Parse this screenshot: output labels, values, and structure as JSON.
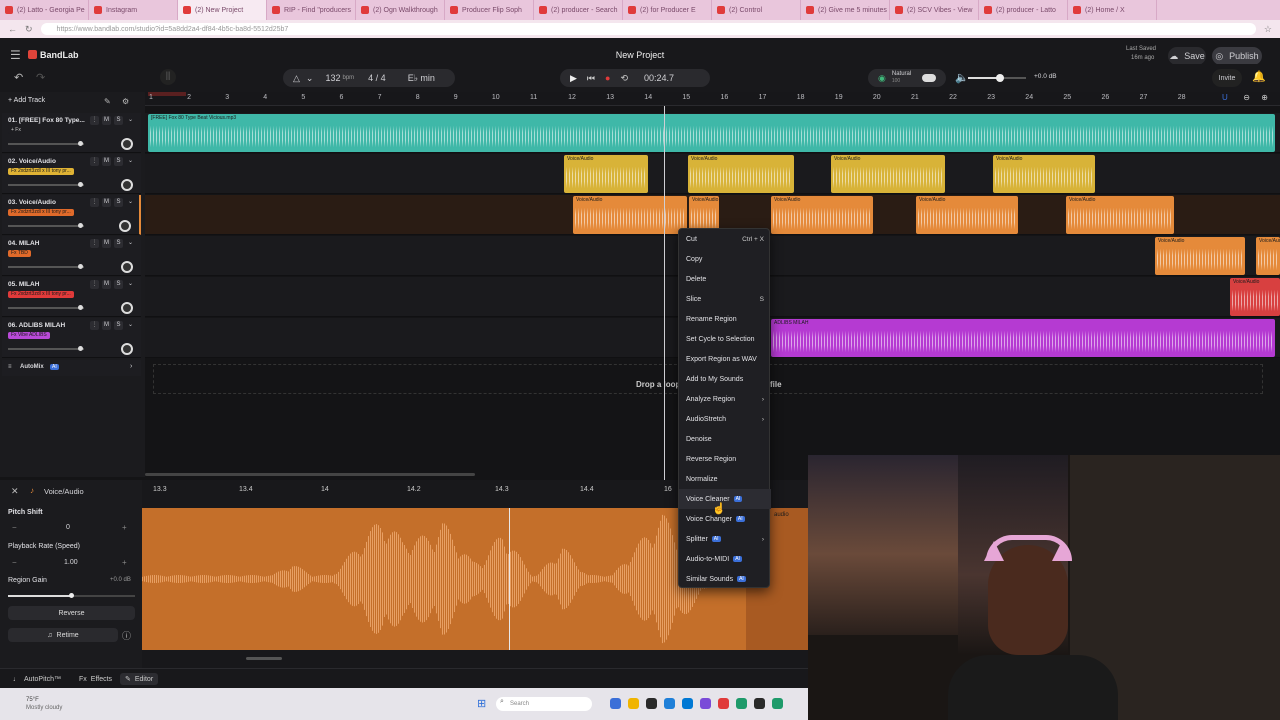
{
  "browser": {
    "tabs": [
      "(2) Latto - Georgia Pe",
      "Instagram",
      "(2) New Project",
      "RIP - Find \"producers",
      "(2) Ogn Walkthrough",
      "Producer Flip Soph",
      "(2) producer - Search",
      "(2) for Producer E",
      "(2) Control",
      "(2) Give me 5 minutes",
      "(2) SCV Vibes - View",
      "(2) producer - Latto",
      "(2) Home / X"
    ],
    "url": "https://www.bandlab.com/studio?id=5a8dd2a4-df84-4b5c-ba8d-5512d25b7"
  },
  "app": {
    "brand": "BandLab",
    "project_title": "New Project",
    "last_saved_label": "Last Saved",
    "last_saved_time": "16m ago",
    "save_label": "Save",
    "publish_label": "Publish",
    "invite_label": "Invite"
  },
  "toolbar": {
    "tempo": "132",
    "tempo_unit": "bpm",
    "time_sig": "4 / 4",
    "key": "E♭ min",
    "time": "00:24.7",
    "mode": "Natural",
    "mode_sub": "100",
    "master_db": "+0.0 dB",
    "master_volume": 0.55
  },
  "tracks_panel": {
    "add_track_label": "Add Track",
    "automix_label": "AutoMix",
    "ai_label": "AI",
    "drop_text_left": "Drop a loop",
    "drop_text_right": "file"
  },
  "ruler": [
    "1",
    "2",
    "3",
    "4",
    "5",
    "6",
    "7",
    "8",
    "9",
    "10",
    "11",
    "12",
    "13",
    "14",
    "15",
    "16",
    "17",
    "18",
    "19",
    "20",
    "21",
    "22",
    "23",
    "24",
    "25",
    "26",
    "27",
    "28"
  ],
  "tracks": [
    {
      "name": "01. [FREE] Fox 80 Type...",
      "fx": "+ Fx",
      "fx_color": "#1d1d21",
      "color": "#3fb8a8"
    },
    {
      "name": "02. Voice/Audio",
      "fx": "Fx 2xdzrt3zdl x III tony pr...",
      "fx_color": "#e0b334",
      "color": "#d8b338"
    },
    {
      "name": "03. Voice/Audio",
      "fx": "Fx 2xdzrt3zdl x III tony pr...",
      "fx_color": "#e06a2a",
      "color": "#e58a3a"
    },
    {
      "name": "04. MILAH",
      "fx": "Fx TBD",
      "fx_color": "#e06a2a",
      "color": "#e58a3a"
    },
    {
      "name": "05. MILAH",
      "fx": "Fx 2xdzrt3zdl x III tony pr...",
      "fx_color": "#e03a3a",
      "color": "#d84040"
    },
    {
      "name": "06. ADLIBS MILAH",
      "fx": "Fx Vibe ADLIBS",
      "fx_color": "#b94ad8",
      "color": "#b53ad2"
    }
  ],
  "regions": {
    "track1": "[FREE] Fox 80 Type Beat Vicious.mp3",
    "voice": "Voice/Audio",
    "adlibs": "ADLIBS MILAH"
  },
  "context_menu": [
    {
      "label": "Cut",
      "shortcut": "Ctrl + X"
    },
    {
      "label": "Copy",
      "shortcut": ""
    },
    {
      "label": "Delete",
      "shortcut": ""
    },
    {
      "label": "Slice",
      "shortcut": "S"
    },
    {
      "label": "Rename Region",
      "shortcut": ""
    },
    {
      "label": "Set Cycle to Selection",
      "shortcut": ""
    },
    {
      "label": "Export Region as WAV",
      "shortcut": ""
    },
    {
      "label": "Add to My Sounds",
      "shortcut": ""
    },
    {
      "label": "Analyze Region",
      "shortcut": "›"
    },
    {
      "label": "AudioStretch",
      "shortcut": "›"
    },
    {
      "label": "Denoise",
      "shortcut": ""
    },
    {
      "label": "Reverse Region",
      "shortcut": ""
    },
    {
      "label": "Normalize",
      "shortcut": ""
    },
    {
      "label": "Voice Cleaner",
      "shortcut": "",
      "ai": "AI"
    },
    {
      "label": "Voice Changer",
      "shortcut": "",
      "ai": "AI"
    },
    {
      "label": "Splitter",
      "shortcut": "›",
      "ai": "AI"
    },
    {
      "label": "Audio-to-MIDI",
      "shortcut": "",
      "ai": "AI"
    },
    {
      "label": "Similar Sounds",
      "shortcut": "",
      "ai": "AI"
    }
  ],
  "editor": {
    "title": "Voice/Audio",
    "pitch_shift_label": "Pitch Shift",
    "pitch_value": "0",
    "playback_rate_label": "Playback Rate (Speed)",
    "playback_value": "1.00",
    "region_gain_label": "Region Gain",
    "region_gain_value": "+0.0 dB",
    "reverse_label": "Reverse",
    "retime_label": "Retime",
    "ruler": [
      "13.3",
      "13.4",
      "14",
      "14.2",
      "14.3",
      "14.4",
      "16"
    ],
    "bottom_tabs": [
      "AutoPitch™",
      "Effects",
      "Editor"
    ],
    "side_region_label": "audio"
  },
  "taskbar": {
    "weather_temp": "75°F",
    "weather_desc": "Mostly cloudy",
    "search_placeholder": "Search"
  }
}
